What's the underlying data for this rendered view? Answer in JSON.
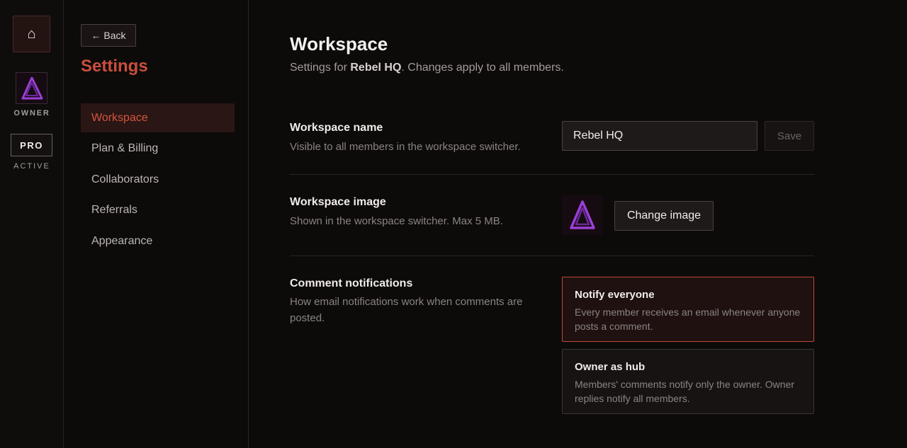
{
  "rail": {
    "home_icon": "home-icon",
    "role_label": "OWNER",
    "plan_badge": "PRO",
    "plan_status": "ACTIVE"
  },
  "nav": {
    "back_label": "← Back",
    "title": "Settings",
    "items": [
      {
        "label": "Workspace",
        "active": true
      },
      {
        "label": "Plan & Billing",
        "active": false
      },
      {
        "label": "Collaborators",
        "active": false
      },
      {
        "label": "Referrals",
        "active": false
      },
      {
        "label": "Appearance",
        "active": false
      }
    ]
  },
  "main": {
    "title": "Workspace",
    "subtitle_prefix": "Settings for ",
    "workspace_name_bold": "Rebel HQ",
    "subtitle_suffix": ". Changes apply to all members.",
    "name_section": {
      "label": "Workspace name",
      "description": "Visible to all members in the workspace switcher.",
      "input_value": "Rebel HQ",
      "save_label": "Save"
    },
    "image_section": {
      "label": "Workspace image",
      "description": "Shown in the workspace switcher. Max 5 MB.",
      "change_label": "Change image"
    },
    "notify_section": {
      "label": "Comment notifications",
      "description": "How email notifications work when comments are posted.",
      "options": [
        {
          "title": "Notify everyone",
          "description": "Every member receives an email whenever anyone posts a comment.",
          "selected": true
        },
        {
          "title": "Owner as hub",
          "description": "Members' comments notify only the owner. Owner replies notify all members.",
          "selected": false
        }
      ]
    }
  },
  "colors": {
    "accent": "#c94f3e",
    "logo_purple": "#9b3fd6"
  }
}
